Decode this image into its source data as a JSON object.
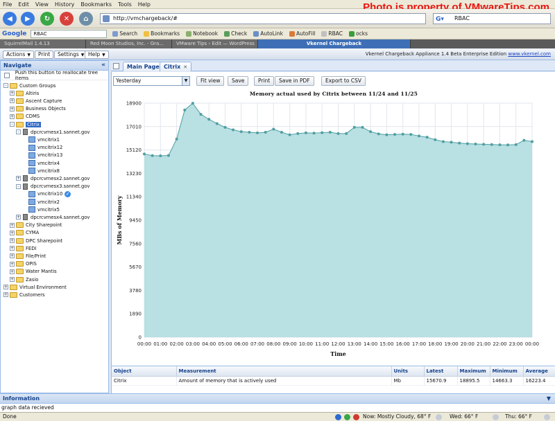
{
  "browser": {
    "menu": [
      "File",
      "Edit",
      "View",
      "History",
      "Bookmarks",
      "Tools",
      "Help"
    ],
    "watermark": "Photo is property of VMwareTips.com",
    "url": "http://vmchargeback/#",
    "search_value": "RBAC",
    "google_box": "RBAC",
    "toolbar_items": [
      "Search",
      "Bookmarks",
      "Notebook",
      "Check",
      "AutoLink",
      "AutoFill",
      "RBAC",
      "ocks"
    ],
    "tabs": [
      "SquirrelMail 1.4.13",
      "Red Moon Studios, Inc. - Gra...",
      "VMware Tips › Edit — WordPress",
      "Vkernel Chargeback"
    ]
  },
  "appbar": {
    "actions": "Actions",
    "print": "Print",
    "settings": "Settings",
    "help": "Help",
    "info": "Vkernel Chargeback Appliance 1.4 Beta Enterprise Edition",
    "link": "www.vkernel.com"
  },
  "nav": {
    "title": "Navigate",
    "push_label": "Push this button to reallocate tree items",
    "tree": [
      {
        "label": "Custom Groups",
        "level": 0,
        "kind": "folder",
        "toggle": "-"
      },
      {
        "label": "Altiris",
        "level": 1,
        "kind": "folder",
        "toggle": "+"
      },
      {
        "label": "Ascent Capture",
        "level": 1,
        "kind": "folder",
        "toggle": "+"
      },
      {
        "label": "Business Objects",
        "level": 1,
        "kind": "folder",
        "toggle": "+"
      },
      {
        "label": "CDMS",
        "level": 1,
        "kind": "folder",
        "toggle": "+"
      },
      {
        "label": "Citrix",
        "level": 1,
        "kind": "folder",
        "toggle": "-",
        "selected": true
      },
      {
        "label": "dpcrcvmesx1.sannet.gov",
        "level": 2,
        "kind": "server",
        "toggle": "-"
      },
      {
        "label": "vmcitrix1",
        "level": 3,
        "kind": "vm",
        "toggle": ""
      },
      {
        "label": "vmcitrix12",
        "level": 3,
        "kind": "vm",
        "toggle": ""
      },
      {
        "label": "vmcitrix13",
        "level": 3,
        "kind": "vm",
        "toggle": ""
      },
      {
        "label": "vmcitrix4",
        "level": 3,
        "kind": "vm",
        "toggle": ""
      },
      {
        "label": "vmcitrix8",
        "level": 3,
        "kind": "vm",
        "toggle": ""
      },
      {
        "label": "dpcrcvmesx2.sannet.gov",
        "level": 2,
        "kind": "server",
        "toggle": "+"
      },
      {
        "label": "dpcrcvmesx3.sannet.gov",
        "level": 2,
        "kind": "server",
        "toggle": "-"
      },
      {
        "label": "vmcitrix10",
        "level": 3,
        "kind": "vm",
        "toggle": "",
        "badge": true
      },
      {
        "label": "vmcitrix2",
        "level": 3,
        "kind": "vm",
        "toggle": ""
      },
      {
        "label": "vmcitrix5",
        "level": 3,
        "kind": "vm",
        "toggle": ""
      },
      {
        "label": "dpcrcvmesx4.sannet.gov",
        "level": 2,
        "kind": "server",
        "toggle": "+"
      },
      {
        "label": "City Sharepoint",
        "level": 1,
        "kind": "folder",
        "toggle": "+"
      },
      {
        "label": "CYMA",
        "level": 1,
        "kind": "folder",
        "toggle": "+"
      },
      {
        "label": "DPC Sharepoint",
        "level": 1,
        "kind": "folder",
        "toggle": "+"
      },
      {
        "label": "FEDI",
        "level": 1,
        "kind": "folder",
        "toggle": "+"
      },
      {
        "label": "File/Print",
        "level": 1,
        "kind": "folder",
        "toggle": "+"
      },
      {
        "label": "OPIS",
        "level": 1,
        "kind": "folder",
        "toggle": "+"
      },
      {
        "label": "Water Mantis",
        "level": 1,
        "kind": "folder",
        "toggle": "+"
      },
      {
        "label": "Zasio",
        "level": 1,
        "kind": "folder",
        "toggle": "+"
      },
      {
        "label": "Virtual Environment",
        "level": 0,
        "kind": "folder",
        "toggle": "+"
      },
      {
        "label": "Customers",
        "level": 0,
        "kind": "folder",
        "toggle": "+"
      }
    ]
  },
  "main": {
    "tabs": [
      "Main Page",
      "Citrix"
    ],
    "period": "Yesterday",
    "buttons": [
      "Fit view",
      "Save",
      "Print",
      "Save in PDF",
      "Export to CSV"
    ]
  },
  "chart_data": {
    "type": "area",
    "title": "Memory actual used by Citrix between 11/24 and 11/25",
    "xlabel": "Time",
    "ylabel": "MBs of Memory",
    "ylim": [
      0,
      18900
    ],
    "yticks": [
      0,
      1890,
      3780,
      5670,
      7560,
      9450,
      11340,
      13230,
      15120,
      17010,
      18900
    ],
    "xticks": [
      "00:00",
      "01:00",
      "02:00",
      "03:00",
      "04:00",
      "05:00",
      "06:00",
      "07:00",
      "08:00",
      "09:00",
      "10:00",
      "11:00",
      "12:00",
      "13:00",
      "14:00",
      "15:00",
      "16:00",
      "17:00",
      "18:00",
      "19:00",
      "20:00",
      "21:00",
      "22:00",
      "23:00",
      "00:00"
    ],
    "x": [
      0,
      0.5,
      1,
      1.5,
      2,
      2.5,
      3,
      3.5,
      4,
      4.5,
      5,
      5.5,
      6,
      6.5,
      7,
      7.5,
      8,
      8.5,
      9,
      9.5,
      10,
      10.5,
      11,
      11.5,
      12,
      12.5,
      13,
      13.5,
      14,
      14.5,
      15,
      15.5,
      16,
      16.5,
      17,
      17.5,
      18,
      18.5,
      19,
      19.5,
      20,
      20.5,
      21,
      21.5,
      22,
      22.5,
      23,
      23.5,
      24
    ],
    "values": [
      14800,
      14663,
      14650,
      14680,
      16000,
      18350,
      18895,
      18000,
      17600,
      17250,
      16950,
      16750,
      16600,
      16550,
      16500,
      16550,
      16800,
      16550,
      16350,
      16450,
      16500,
      16480,
      16520,
      16550,
      16450,
      16450,
      16950,
      16950,
      16600,
      16420,
      16350,
      16380,
      16400,
      16380,
      16250,
      16150,
      15950,
      15800,
      15750,
      15680,
      15630,
      15600,
      15580,
      15560,
      15540,
      15530,
      15550,
      15900,
      15800,
      15671
    ],
    "grid": true,
    "legend": "none",
    "color": "#b9e0e2",
    "line_color": "#4f9ea2"
  },
  "table": {
    "headers": [
      "Object",
      "Measurement",
      "Units",
      "Latest",
      "Maximum",
      "Minimum",
      "Average"
    ],
    "rows": [
      [
        "Citrix",
        "Amount of memory that is actively used",
        "Mb",
        "15670.9",
        "18895.5",
        "14663.3",
        "16223.4"
      ]
    ]
  },
  "info": {
    "title": "Information",
    "message": "graph data recieved"
  },
  "status": {
    "done": "Done",
    "weather": [
      "Now: Mostly Cloudy, 68° F",
      "Wed: 66° F",
      "Thu: 66° F"
    ]
  }
}
